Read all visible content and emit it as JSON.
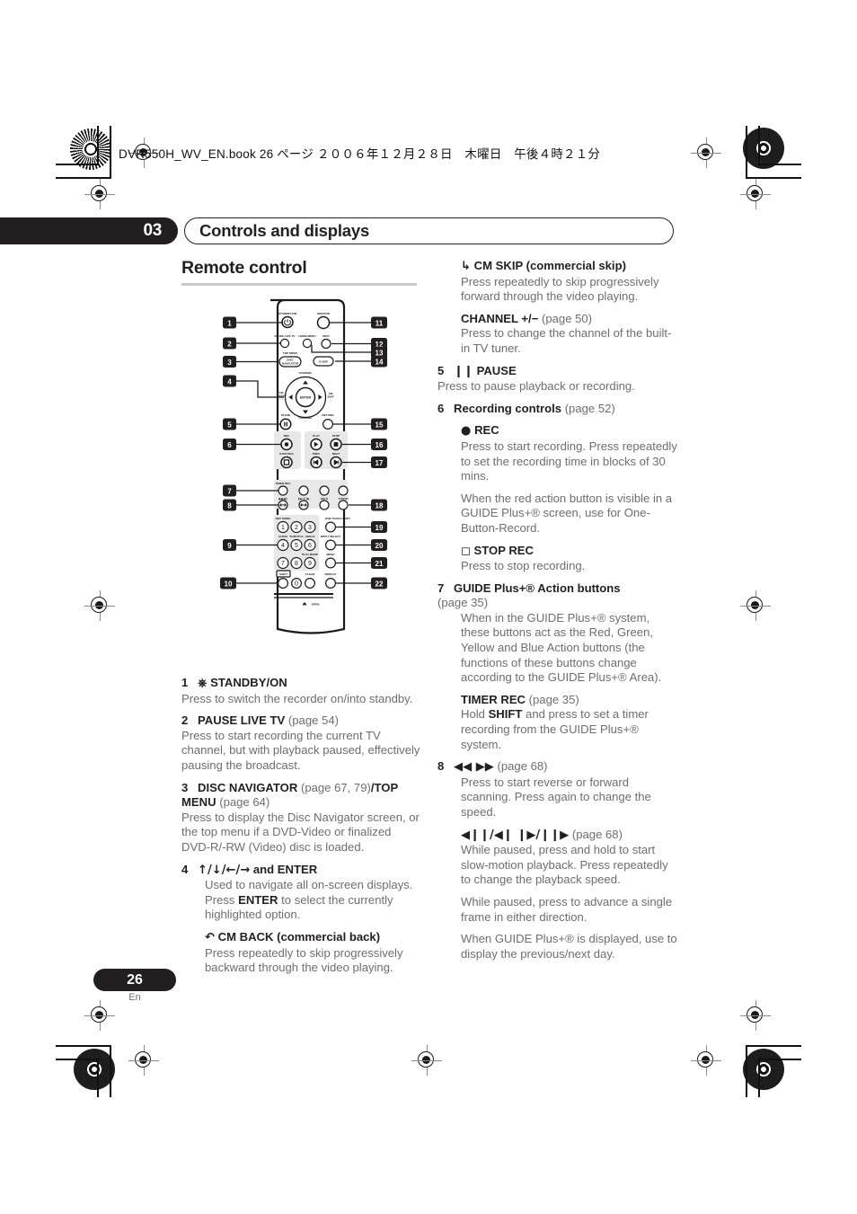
{
  "file_header": "DVR550H_WV_EN.book  26 ページ  ２００６年１２月２８日　木曜日　午後４時２１分",
  "chapter": {
    "number": "03",
    "title": "Controls and displays"
  },
  "section": {
    "heading": "Remote control"
  },
  "page_footer": {
    "number": "26",
    "language": "En"
  },
  "figure": {
    "caption_open": "OPEN",
    "callouts_left": [
      "1",
      "2",
      "3",
      "4",
      "5",
      "6",
      "7",
      "8",
      "9",
      "10"
    ],
    "callouts_right": [
      "11",
      "12",
      "13",
      "14",
      "15",
      "16",
      "17",
      "18",
      "19",
      "20",
      "21",
      "22"
    ],
    "button_labels": {
      "standby": "STANDBY/ON",
      "hdd_dvd": "HDD/DVD",
      "pause_live_tv": "PAUSE LIVE TV",
      "home_menu": "HOME MENU",
      "info": "INFO",
      "top_menu": "TOP MENU",
      "disc_navigator": "DISC NAVIGATOR",
      "guide": "GUIDE",
      "channel_plus": "CHANNEL +",
      "channel_minus": "CHANNEL −",
      "enter": "ENTER",
      "cm_back": "CM BACK",
      "cm_skip": "CM SKIP",
      "pause": "PAUSE",
      "return": "RETURN",
      "rec": "REC",
      "play": "PLAY",
      "stop": "STOP",
      "stop_rec": "STOP REC",
      "prev": "PREV",
      "next": "NEXT",
      "timer_rec": "TIMER REC",
      "help": "HELP",
      "tv_dvd": "TV/DVD",
      "rec_mode": "REC MODE",
      "one_touch_copy": "ONE TOUCH COPY",
      "audio": "AUDIO",
      "subtitle": "SUBTITLE",
      "angle": "ANGLE",
      "input_select": "INPUT SELECT",
      "play_mode": "PLAY MODE",
      "menu": "MENU",
      "shift": "SHIFT",
      "clear": "CLEAR",
      "display": "DISPLAY",
      "digits": [
        "1",
        "2",
        "3",
        "4",
        "5",
        "6",
        "7",
        "8",
        "9",
        "0"
      ]
    }
  },
  "left_column": [
    {
      "id": "item-1",
      "number": "1",
      "icon": "power-icon",
      "title": "STANDBY/ON",
      "body": [
        "Press to switch the recorder on/into standby."
      ]
    },
    {
      "id": "item-2",
      "number": "2",
      "title": "PAUSE LIVE TV",
      "page": "(page 54)",
      "body": [
        "Press to start recording the current TV channel, but with playback paused, effectively pausing the broadcast."
      ]
    },
    {
      "id": "item-3",
      "number": "3",
      "title": "DISC NAVIGATOR",
      "page": "(page 67, 79)",
      "title2": "/TOP MENU",
      "page2": "(page 64)",
      "body": [
        "Press to display the Disc Navigator screen, or the top menu if a DVD-Video or finalized DVD-R/-RW (Video) disc is loaded."
      ]
    },
    {
      "id": "item-4",
      "number": "4",
      "title": "and ENTER",
      "arrows": "↑/↓/←/→",
      "body_pre": "Used to navigate all on-screen displays. Press ",
      "body_bold": "ENTER",
      "body_post": " to select the currently highlighted option."
    },
    {
      "id": "item-4-cmback",
      "icon": "cm-back-icon",
      "title": "CM BACK (commercial back)",
      "body": [
        "Press repeatedly to skip progressively backward through the video playing."
      ]
    }
  ],
  "right_column": [
    {
      "id": "item-cmskip",
      "icon": "cm-skip-icon",
      "title": "CM SKIP (commercial skip)",
      "body": [
        "Press repeatedly to skip progressively forward through the video playing."
      ]
    },
    {
      "id": "item-channel",
      "title": "CHANNEL +/−",
      "page": "(page 50)",
      "body": [
        "Press to change the channel of the built-in TV tuner."
      ]
    },
    {
      "id": "item-5",
      "number": "5",
      "icon": "pause-icon",
      "title": "PAUSE",
      "body": [
        "Press to pause playback or recording."
      ]
    },
    {
      "id": "item-6",
      "number": "6",
      "title": "Recording controls",
      "page": "(page 52)"
    },
    {
      "id": "item-6-rec",
      "icon": "record-dot-icon",
      "title": "REC",
      "body": [
        "Press to start recording. Press repeatedly to set the recording time in blocks of 30 mins.",
        "When the red action button is visible in a GUIDE Plus+® screen, use for One-Button-Record."
      ]
    },
    {
      "id": "item-6-stoprec",
      "icon": "stop-square-icon",
      "title": "STOP REC",
      "body": [
        "Press to stop recording."
      ]
    },
    {
      "id": "item-7",
      "number": "7",
      "title": "GUIDE Plus+® Action buttons",
      "page": "(page 35)",
      "body": [
        "When in the GUIDE Plus+® system, these buttons act as the Red, Green, Yellow and Blue Action buttons (the functions of these buttons change according to the GUIDE Plus+® Area)."
      ]
    },
    {
      "id": "item-7-timer",
      "title": "TIMER REC",
      "page": "(page 35)",
      "body_pre": "Hold ",
      "body_bold": "SHIFT",
      "body_post": " and press to set a timer recording from the GUIDE Plus+® system."
    },
    {
      "id": "item-8",
      "number": "8",
      "icons": "◀◀  ▶▶",
      "page": "(page 68)",
      "body": [
        "Press to start reverse or forward scanning. Press again to change the speed."
      ]
    },
    {
      "id": "item-8-slow",
      "icons": "◀❙❙/◀❙  ❙▶/❙❙▶",
      "page": "(page 68)",
      "body": [
        "While paused, press and hold to start slow-motion playback. Press repeatedly to change the playback speed.",
        "While paused, press to advance a single frame in either direction.",
        "When GUIDE Plus+® is displayed, use to display the previous/next day."
      ]
    }
  ]
}
